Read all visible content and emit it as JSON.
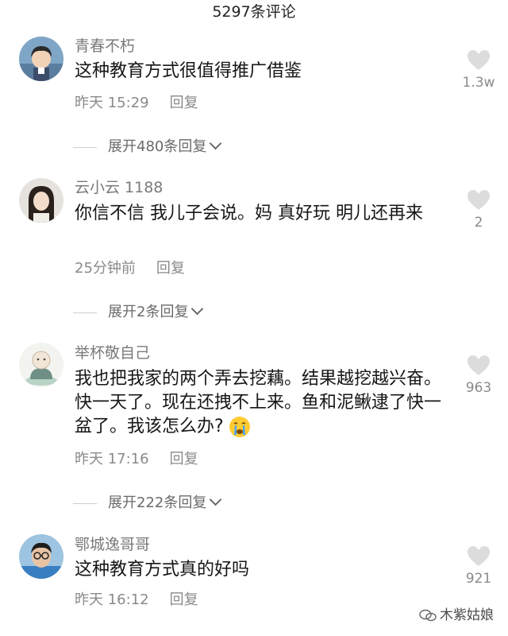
{
  "header": {
    "title": "5297条评论"
  },
  "comments": [
    {
      "username": "青春不朽",
      "text": "这种教育方式很值得推广借鉴",
      "time": "昨天 15:29",
      "reply_label": "回复",
      "likes": "1.3w",
      "expand_label": "展开480条回复",
      "avatar_icon": "anime-boy-avatar"
    },
    {
      "username": "云小云 1188",
      "text": "你信不信  我儿子会说。妈 真好玩 明儿还再来",
      "time": "25分钟前",
      "reply_label": "回复",
      "likes": "2",
      "expand_label": "展开2条回复",
      "avatar_icon": "woman-avatar"
    },
    {
      "username": "举杯敬自己",
      "text": "我也把我家的两个弄去挖藕。结果越挖越兴奋。快一天了。现在还拽不上来。鱼和泥鳅逮了快一盆了。我该怎么办?",
      "time": "昨天 17:16",
      "reply_label": "回复",
      "likes": "963",
      "expand_label": "展开222条回复",
      "avatar_icon": "cartoon-monk-avatar",
      "emoji_icon": "crying-face-icon"
    },
    {
      "username": "鄂城逸哥哥",
      "text": "这种教育方式真的好吗",
      "time": "昨天 16:12",
      "reply_label": "回复",
      "likes": "921",
      "avatar_icon": "child-glasses-avatar"
    }
  ],
  "watermark": {
    "text": "木紫姑娘",
    "icon": "wechat-official-account-icon"
  },
  "colors": {
    "like_heart": "#dcdcdc",
    "text": "#161616",
    "meta": "#8a8a8a"
  }
}
